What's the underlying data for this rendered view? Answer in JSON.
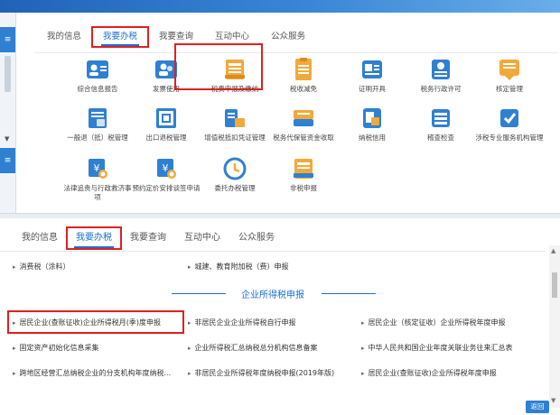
{
  "top_panel": {
    "tabs": [
      {
        "label": "我的信息"
      },
      {
        "label": "我要办税"
      },
      {
        "label": "我要查询"
      },
      {
        "label": "互动中心"
      },
      {
        "label": "公众服务"
      }
    ],
    "items": [
      {
        "label": "综合信息报告",
        "icon": "id-card-icon"
      },
      {
        "label": "发票使用",
        "icon": "invoice-user-icon"
      },
      {
        "label": "税费申报及缴纳",
        "icon": "tax-declare-icon"
      },
      {
        "label": "税收减免",
        "icon": "tax-relief-icon"
      },
      {
        "label": "证明开具",
        "icon": "certificate-icon"
      },
      {
        "label": "税务行政许可",
        "icon": "permit-icon"
      },
      {
        "label": "核定管理",
        "icon": "approval-icon"
      },
      {
        "label": "一般退（抵）税管理",
        "icon": "refund-icon"
      },
      {
        "label": "出口退税管理",
        "icon": "export-refund-icon"
      },
      {
        "label": "增值税抵扣凭证管理",
        "icon": "vat-voucher-icon"
      },
      {
        "label": "税务代保管资金收取",
        "icon": "custody-funds-icon"
      },
      {
        "label": "纳税信用",
        "icon": "credit-icon"
      },
      {
        "label": "稽查检查",
        "icon": "inspection-icon"
      },
      {
        "label": "涉税专业服务机构管理",
        "icon": "agency-icon"
      },
      {
        "label": "法律追责与行政救济事项",
        "icon": "legal-yuan-icon"
      },
      {
        "label": "预约定价安排谈签申请",
        "icon": "pricing-yuan-icon"
      },
      {
        "label": "委托办税管理",
        "icon": "delegate-icon"
      },
      {
        "label": "非税申报",
        "icon": "non-tax-icon"
      }
    ]
  },
  "bottom_panel": {
    "tabs": [
      {
        "label": "我的信息"
      },
      {
        "label": "我要办税"
      },
      {
        "label": "我要查询"
      },
      {
        "label": "互动中心"
      },
      {
        "label": "公众服务"
      }
    ],
    "top_links": [
      {
        "label": "消费税（涂料）"
      },
      {
        "label": "城建、教育附加税（费）申报"
      }
    ],
    "section_title": "企业所得税申报",
    "rows": [
      [
        "居民企业(查账征收)企业所得税月(季)度申报",
        "非居民企业企业所得税自行申报",
        "居民企业（核定征收）企业所得税年度申报"
      ],
      [
        "固定资产初始化信息采集",
        "企业所得税汇总纳税总分机构信息备案",
        "中华人民共和国企业年度关联业务往来汇总表"
      ],
      [
        "跨地区经营汇总纳税企业的分支机构年度纳税...",
        "非居民企业所得税年度纳税申报(2019年版)",
        "居民企业(查账征收)企业所得税年度申报"
      ]
    ],
    "return_label": "返回"
  },
  "colors": {
    "accent": "#1c6fd1",
    "highlight_box": "#e02020"
  }
}
